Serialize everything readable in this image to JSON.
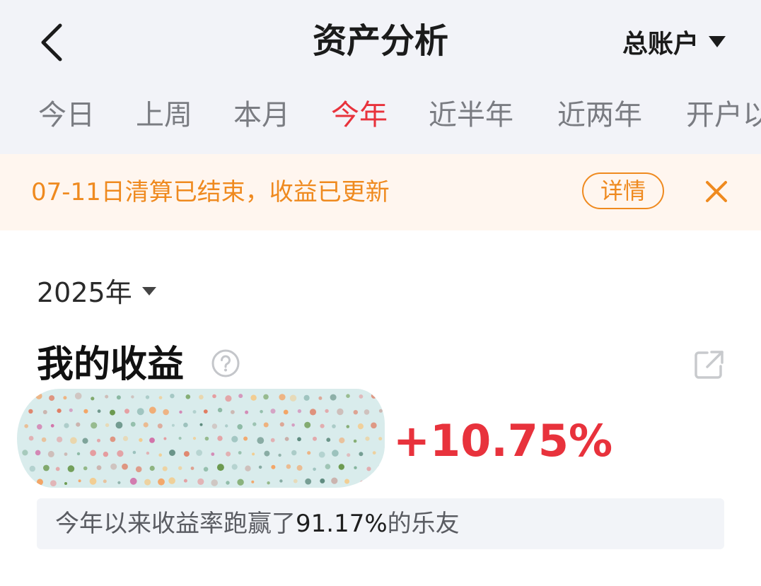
{
  "header": {
    "title": "资产分析",
    "account_label": "总账户",
    "icons": {
      "back": "chevron-left-icon",
      "account": "caret-down-icon"
    }
  },
  "tabs": [
    {
      "label": "今日",
      "active": false
    },
    {
      "label": "上周",
      "active": false
    },
    {
      "label": "本月",
      "active": false
    },
    {
      "label": "今年",
      "active": true
    },
    {
      "label": "近半年",
      "active": false
    },
    {
      "label": "近两年",
      "active": false
    },
    {
      "label": "开户以",
      "active": false
    }
  ],
  "notice": {
    "text": "07-11日清算已结束，收益已更新",
    "detail_label": "详情",
    "close_icon": "close-icon"
  },
  "earnings": {
    "year_label": "2025年",
    "title": "我的收益",
    "return_rate": "+10.75%",
    "beat_prefix": "今年以来收益率跑赢了",
    "beat_value": "91.17%",
    "beat_suffix": "的乐友",
    "icons": {
      "help": "question-circle-icon",
      "share": "share-external-icon"
    }
  },
  "colors": {
    "accent_red": "#e8323c",
    "notice_orange": "#ef8a1f",
    "header_bg": "#f2f3f8",
    "notice_bg": "#fff6ef"
  }
}
